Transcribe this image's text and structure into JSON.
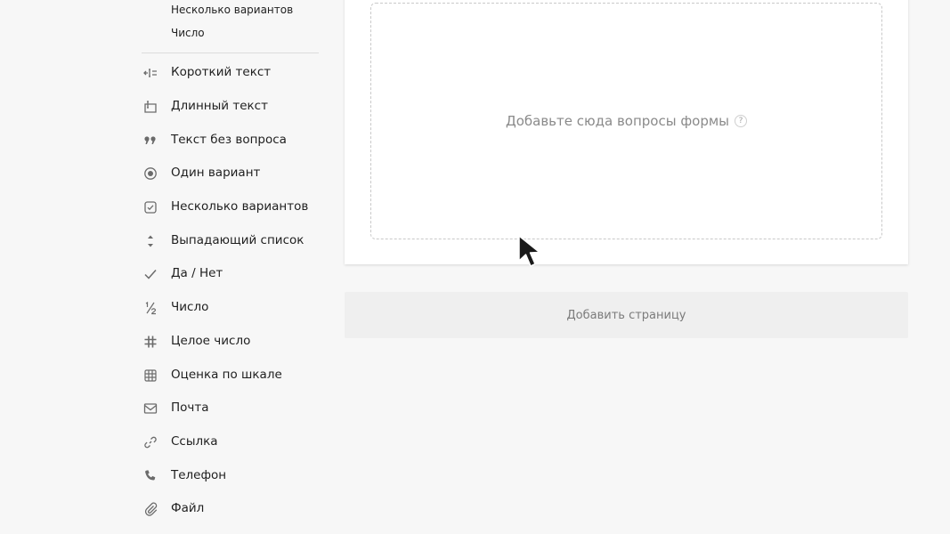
{
  "sidebar": {
    "sub_items": [
      {
        "label": "Несколько вариантов"
      },
      {
        "label": "Число"
      }
    ],
    "items": [
      {
        "label": "Короткий текст",
        "icon": "short-text-icon"
      },
      {
        "label": "Длинный текст",
        "icon": "long-text-icon"
      },
      {
        "label": "Текст без вопроса",
        "icon": "quote-icon"
      },
      {
        "label": "Один вариант",
        "icon": "radio-icon"
      },
      {
        "label": "Несколько вариантов",
        "icon": "checkbox-icon"
      },
      {
        "label": "Выпадающий список",
        "icon": "dropdown-icon"
      },
      {
        "label": "Да / Нет",
        "icon": "checkmark-icon"
      },
      {
        "label": "Число",
        "icon": "fraction-icon"
      },
      {
        "label": "Целое число",
        "icon": "hash-icon"
      },
      {
        "label": "Оценка по шкале",
        "icon": "grid-scale-icon"
      },
      {
        "label": "Почта",
        "icon": "envelope-icon"
      },
      {
        "label": "Ссылка",
        "icon": "link-icon"
      },
      {
        "label": "Телефон",
        "icon": "phone-icon"
      },
      {
        "label": "Файл",
        "icon": "paperclip-icon"
      }
    ]
  },
  "main": {
    "dropzone_text": "Добавьте сюда вопросы формы",
    "help_glyph": "?",
    "add_page_label": "Добавить страницу"
  },
  "colors": {
    "background": "#f7f7f7",
    "card": "#ffffff",
    "muted_text": "#8a8a8a",
    "icon": "#6b6b6b"
  }
}
